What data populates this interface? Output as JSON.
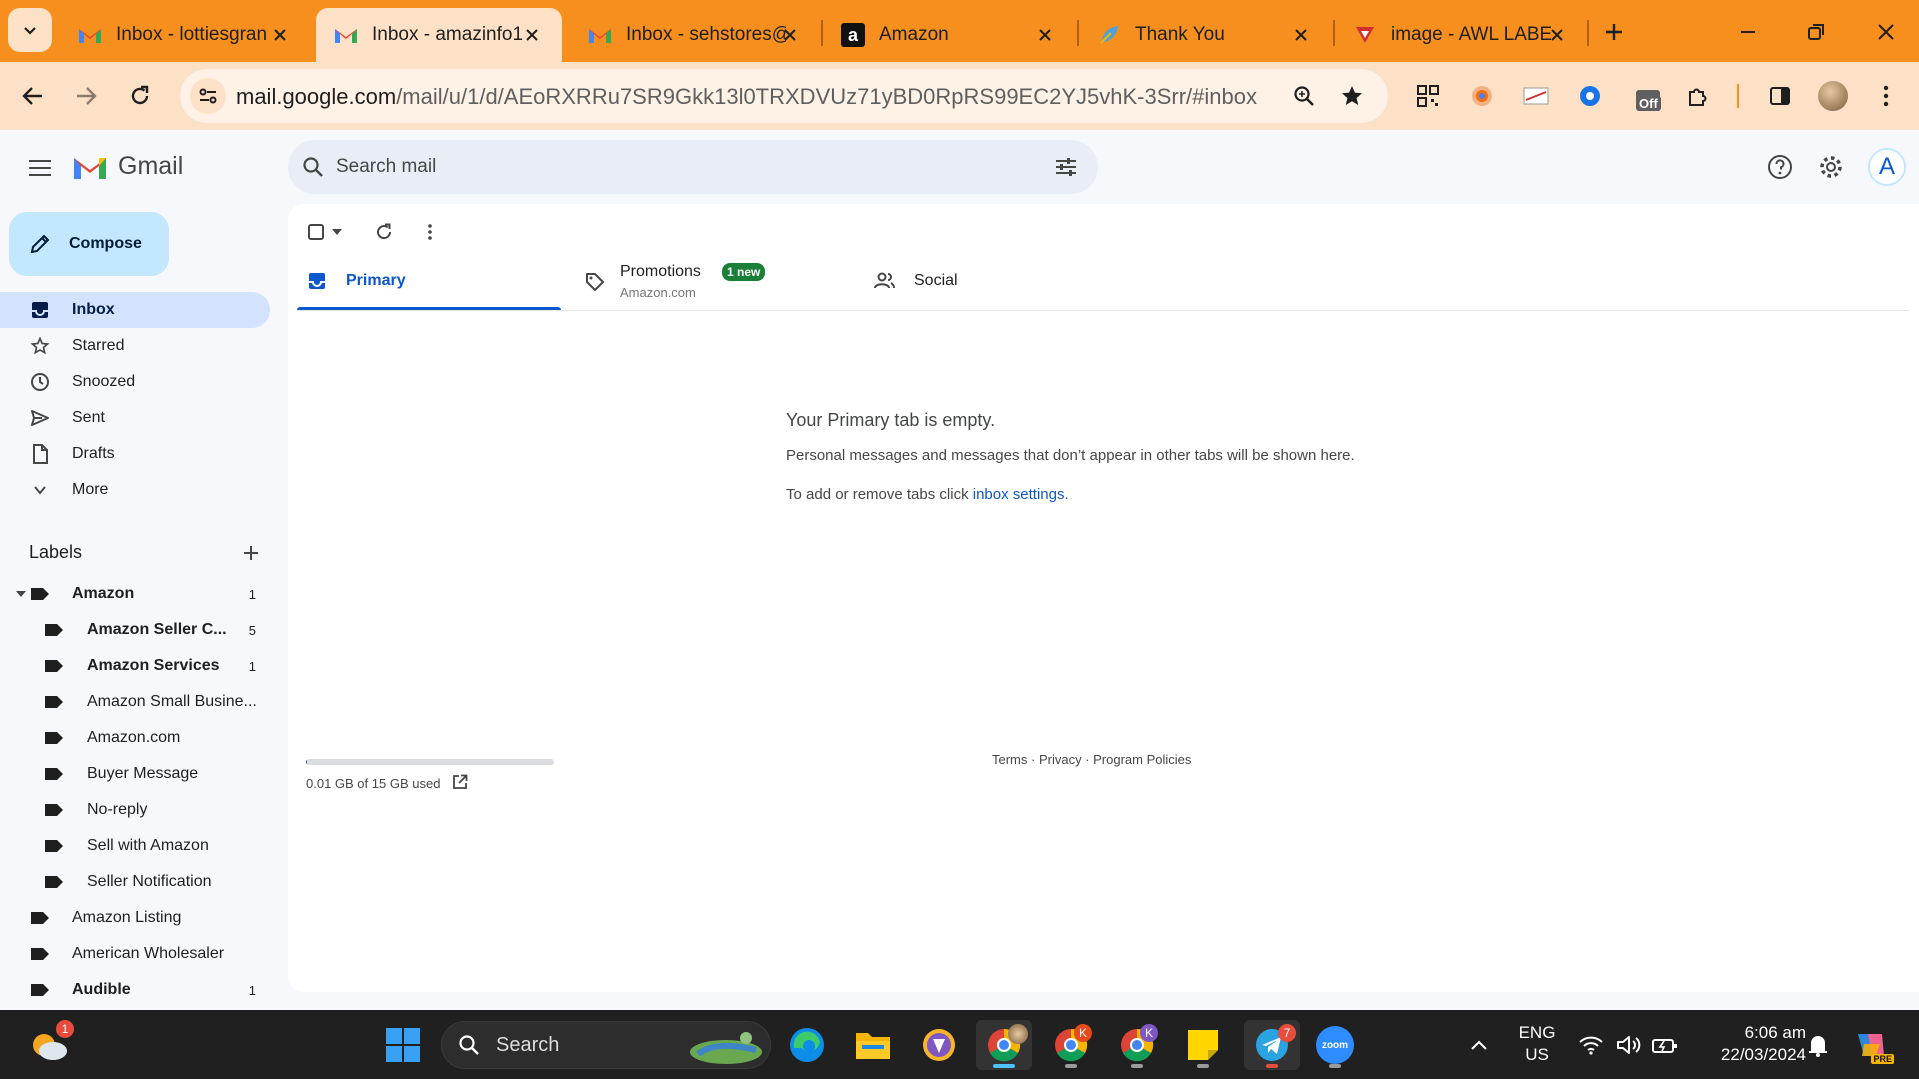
{
  "browser": {
    "tabs": [
      {
        "title": "Inbox - lottiesgran",
        "icon": "gmail-icon"
      },
      {
        "title": "Inbox - amazinfo1",
        "icon": "gmail-icon",
        "active": true
      },
      {
        "title": "Inbox - sehstores@",
        "icon": "gmail-icon"
      },
      {
        "title": "Amazon",
        "icon": "amazon-icon"
      },
      {
        "title": "Thank You",
        "icon": "feather-icon"
      },
      {
        "title": "image - AWL LABE",
        "icon": "pdf-icon"
      }
    ],
    "url_host": "mail.google.com",
    "url_path": "/mail/u/1/d/AEoRXRRu7SR9Gkk13l0TRXDVUz71yBD0RpRS99EC2YJ5vhK-3Srr/#inbox",
    "extension_off_badge": "Off",
    "colors": {
      "tabstrip": "#f68f1e",
      "toolbar": "#fde1c6"
    }
  },
  "gmail": {
    "brand": "Gmail",
    "search_placeholder": "Search mail",
    "compose_label": "Compose",
    "account_initial": "A",
    "nav": [
      {
        "label": "Inbox",
        "icon": "inbox-icon",
        "selected": true
      },
      {
        "label": "Starred",
        "icon": "star-icon"
      },
      {
        "label": "Snoozed",
        "icon": "clock-icon"
      },
      {
        "label": "Sent",
        "icon": "send-icon"
      },
      {
        "label": "Drafts",
        "icon": "draft-icon"
      },
      {
        "label": "More",
        "icon": "chevron-down-icon"
      }
    ],
    "labels_heading": "Labels",
    "labels": [
      {
        "name": "Amazon",
        "count": "1",
        "bold": true
      },
      {
        "name": "Amazon Seller C...",
        "count": "5",
        "bold": true
      },
      {
        "name": "Amazon Services",
        "count": "1",
        "bold": true
      },
      {
        "name": "Amazon Small Busine...",
        "count": ""
      },
      {
        "name": "Amazon.com",
        "count": ""
      },
      {
        "name": "Buyer Message",
        "count": ""
      },
      {
        "name": "No-reply",
        "count": ""
      },
      {
        "name": "Sell with Amazon",
        "count": ""
      },
      {
        "name": "Seller Notification",
        "count": ""
      },
      {
        "name": "Amazon Listing",
        "count": ""
      },
      {
        "name": "American Wholesaler",
        "count": ""
      },
      {
        "name": "Audible",
        "count": "1",
        "bold": true
      }
    ],
    "category_tabs": {
      "primary": "Primary",
      "promotions": "Promotions",
      "promotions_badge": "1 new",
      "promotions_sub": "Amazon.com",
      "social": "Social"
    },
    "empty": {
      "title": "Your Primary tab is empty.",
      "line1": "Personal messages and messages that don’t appear in other tabs will be shown here.",
      "line2_prefix": "To add or remove tabs click ",
      "line2_link": "inbox settings",
      "line2_suffix": "."
    },
    "storage": {
      "text": "0.01 GB of 15 GB used",
      "used_fraction": 0.001
    },
    "footer": {
      "terms": "Terms",
      "sep1": " · ",
      "privacy": "Privacy",
      "sep2": " · ",
      "policies": "Program Policies"
    },
    "colors": {
      "accent": "#0b57d0",
      "selected_nav": "#d3e3fd",
      "compose": "#c2e7ff",
      "badge": "#188038"
    }
  },
  "taskbar": {
    "search_label": "Search",
    "weather_badge": "1",
    "chrome_badge_k1": "K",
    "chrome_badge_k2": "K",
    "telegram_badge": "7",
    "zoom_label": "zoom",
    "lang_1": "ENG",
    "lang_2": "US",
    "time": "6:06 am",
    "date": "22/03/2024",
    "copilot_badge": "PRE"
  }
}
